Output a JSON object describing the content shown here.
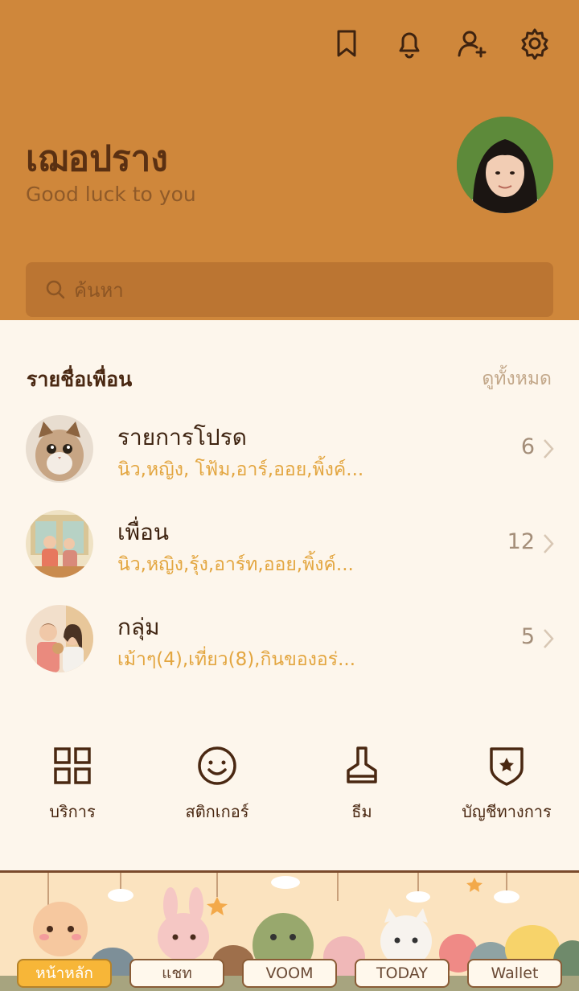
{
  "header": {
    "icons": [
      "bookmark-icon",
      "bell-icon",
      "add-friend-icon",
      "gear-icon"
    ],
    "profile_name": "เฌอปราง",
    "status_message": "Good luck to you",
    "search_placeholder": "ค้นหา",
    "accent_color": "#cf873b"
  },
  "friends": {
    "title": "รายชื่อเพื่อน",
    "see_all": "ดูทั้งหมด",
    "rows": [
      {
        "title": "รายการโปรด",
        "subtitle": "นิว,หญิง, โฟ้ม,อาร์,ออย,พิ้งค์...",
        "count": "6"
      },
      {
        "title": "เพื่อน",
        "subtitle": "นิว,หญิง,รุ้ง,อาร์ท,ออย,พิ้งค์...",
        "count": "12"
      },
      {
        "title": "กลุ่ม",
        "subtitle": "เม้าๆ(4),เที่ยว(8),กินของอร่...",
        "count": "5"
      }
    ]
  },
  "shortcuts": [
    {
      "label": "บริการ",
      "icon": "grid-icon"
    },
    {
      "label": "สติกเกอร์",
      "icon": "smile-icon"
    },
    {
      "label": "ธีม",
      "icon": "brush-icon"
    },
    {
      "label": "บัญชีทางการ",
      "icon": "shield-star-icon"
    }
  ],
  "nav": {
    "tabs": [
      "หน้าหลัก",
      "แชท",
      "VOOM",
      "TODAY",
      "Wallet"
    ],
    "active_index": 0
  }
}
